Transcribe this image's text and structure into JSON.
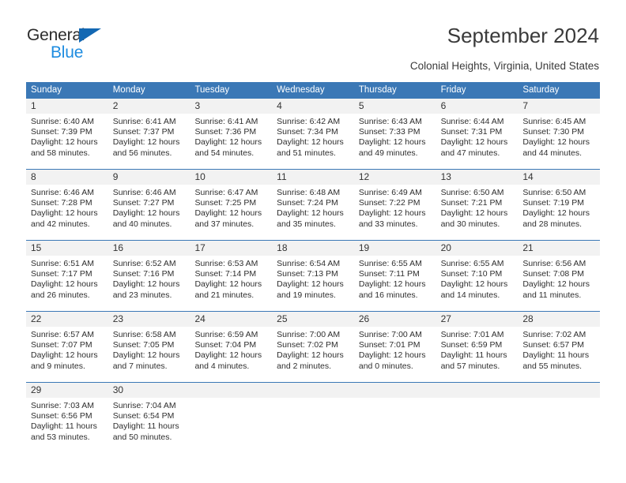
{
  "brand": {
    "name_part1": "General",
    "name_part2": "Blue",
    "accent_color": "#1368b3",
    "blue_text_color": "#1e8ce0"
  },
  "header": {
    "title": "September 2024",
    "subtitle": "Colonial Heights, Virginia, United States"
  },
  "calendar": {
    "header_bg": "#3b78b6",
    "daynum_bg": "#f2f2f2",
    "weekdays": [
      "Sunday",
      "Monday",
      "Tuesday",
      "Wednesday",
      "Thursday",
      "Friday",
      "Saturday"
    ],
    "weeks": [
      {
        "days": [
          {
            "num": "1",
            "sunrise": "Sunrise: 6:40 AM",
            "sunset": "Sunset: 7:39 PM",
            "daylight1": "Daylight: 12 hours",
            "daylight2": "and 58 minutes."
          },
          {
            "num": "2",
            "sunrise": "Sunrise: 6:41 AM",
            "sunset": "Sunset: 7:37 PM",
            "daylight1": "Daylight: 12 hours",
            "daylight2": "and 56 minutes."
          },
          {
            "num": "3",
            "sunrise": "Sunrise: 6:41 AM",
            "sunset": "Sunset: 7:36 PM",
            "daylight1": "Daylight: 12 hours",
            "daylight2": "and 54 minutes."
          },
          {
            "num": "4",
            "sunrise": "Sunrise: 6:42 AM",
            "sunset": "Sunset: 7:34 PM",
            "daylight1": "Daylight: 12 hours",
            "daylight2": "and 51 minutes."
          },
          {
            "num": "5",
            "sunrise": "Sunrise: 6:43 AM",
            "sunset": "Sunset: 7:33 PM",
            "daylight1": "Daylight: 12 hours",
            "daylight2": "and 49 minutes."
          },
          {
            "num": "6",
            "sunrise": "Sunrise: 6:44 AM",
            "sunset": "Sunset: 7:31 PM",
            "daylight1": "Daylight: 12 hours",
            "daylight2": "and 47 minutes."
          },
          {
            "num": "7",
            "sunrise": "Sunrise: 6:45 AM",
            "sunset": "Sunset: 7:30 PM",
            "daylight1": "Daylight: 12 hours",
            "daylight2": "and 44 minutes."
          }
        ]
      },
      {
        "days": [
          {
            "num": "8",
            "sunrise": "Sunrise: 6:46 AM",
            "sunset": "Sunset: 7:28 PM",
            "daylight1": "Daylight: 12 hours",
            "daylight2": "and 42 minutes."
          },
          {
            "num": "9",
            "sunrise": "Sunrise: 6:46 AM",
            "sunset": "Sunset: 7:27 PM",
            "daylight1": "Daylight: 12 hours",
            "daylight2": "and 40 minutes."
          },
          {
            "num": "10",
            "sunrise": "Sunrise: 6:47 AM",
            "sunset": "Sunset: 7:25 PM",
            "daylight1": "Daylight: 12 hours",
            "daylight2": "and 37 minutes."
          },
          {
            "num": "11",
            "sunrise": "Sunrise: 6:48 AM",
            "sunset": "Sunset: 7:24 PM",
            "daylight1": "Daylight: 12 hours",
            "daylight2": "and 35 minutes."
          },
          {
            "num": "12",
            "sunrise": "Sunrise: 6:49 AM",
            "sunset": "Sunset: 7:22 PM",
            "daylight1": "Daylight: 12 hours",
            "daylight2": "and 33 minutes."
          },
          {
            "num": "13",
            "sunrise": "Sunrise: 6:50 AM",
            "sunset": "Sunset: 7:21 PM",
            "daylight1": "Daylight: 12 hours",
            "daylight2": "and 30 minutes."
          },
          {
            "num": "14",
            "sunrise": "Sunrise: 6:50 AM",
            "sunset": "Sunset: 7:19 PM",
            "daylight1": "Daylight: 12 hours",
            "daylight2": "and 28 minutes."
          }
        ]
      },
      {
        "days": [
          {
            "num": "15",
            "sunrise": "Sunrise: 6:51 AM",
            "sunset": "Sunset: 7:17 PM",
            "daylight1": "Daylight: 12 hours",
            "daylight2": "and 26 minutes."
          },
          {
            "num": "16",
            "sunrise": "Sunrise: 6:52 AM",
            "sunset": "Sunset: 7:16 PM",
            "daylight1": "Daylight: 12 hours",
            "daylight2": "and 23 minutes."
          },
          {
            "num": "17",
            "sunrise": "Sunrise: 6:53 AM",
            "sunset": "Sunset: 7:14 PM",
            "daylight1": "Daylight: 12 hours",
            "daylight2": "and 21 minutes."
          },
          {
            "num": "18",
            "sunrise": "Sunrise: 6:54 AM",
            "sunset": "Sunset: 7:13 PM",
            "daylight1": "Daylight: 12 hours",
            "daylight2": "and 19 minutes."
          },
          {
            "num": "19",
            "sunrise": "Sunrise: 6:55 AM",
            "sunset": "Sunset: 7:11 PM",
            "daylight1": "Daylight: 12 hours",
            "daylight2": "and 16 minutes."
          },
          {
            "num": "20",
            "sunrise": "Sunrise: 6:55 AM",
            "sunset": "Sunset: 7:10 PM",
            "daylight1": "Daylight: 12 hours",
            "daylight2": "and 14 minutes."
          },
          {
            "num": "21",
            "sunrise": "Sunrise: 6:56 AM",
            "sunset": "Sunset: 7:08 PM",
            "daylight1": "Daylight: 12 hours",
            "daylight2": "and 11 minutes."
          }
        ]
      },
      {
        "days": [
          {
            "num": "22",
            "sunrise": "Sunrise: 6:57 AM",
            "sunset": "Sunset: 7:07 PM",
            "daylight1": "Daylight: 12 hours",
            "daylight2": "and 9 minutes."
          },
          {
            "num": "23",
            "sunrise": "Sunrise: 6:58 AM",
            "sunset": "Sunset: 7:05 PM",
            "daylight1": "Daylight: 12 hours",
            "daylight2": "and 7 minutes."
          },
          {
            "num": "24",
            "sunrise": "Sunrise: 6:59 AM",
            "sunset": "Sunset: 7:04 PM",
            "daylight1": "Daylight: 12 hours",
            "daylight2": "and 4 minutes."
          },
          {
            "num": "25",
            "sunrise": "Sunrise: 7:00 AM",
            "sunset": "Sunset: 7:02 PM",
            "daylight1": "Daylight: 12 hours",
            "daylight2": "and 2 minutes."
          },
          {
            "num": "26",
            "sunrise": "Sunrise: 7:00 AM",
            "sunset": "Sunset: 7:01 PM",
            "daylight1": "Daylight: 12 hours",
            "daylight2": "and 0 minutes."
          },
          {
            "num": "27",
            "sunrise": "Sunrise: 7:01 AM",
            "sunset": "Sunset: 6:59 PM",
            "daylight1": "Daylight: 11 hours",
            "daylight2": "and 57 minutes."
          },
          {
            "num": "28",
            "sunrise": "Sunrise: 7:02 AM",
            "sunset": "Sunset: 6:57 PM",
            "daylight1": "Daylight: 11 hours",
            "daylight2": "and 55 minutes."
          }
        ]
      },
      {
        "days": [
          {
            "num": "29",
            "sunrise": "Sunrise: 7:03 AM",
            "sunset": "Sunset: 6:56 PM",
            "daylight1": "Daylight: 11 hours",
            "daylight2": "and 53 minutes."
          },
          {
            "num": "30",
            "sunrise": "Sunrise: 7:04 AM",
            "sunset": "Sunset: 6:54 PM",
            "daylight1": "Daylight: 11 hours",
            "daylight2": "and 50 minutes."
          },
          {
            "num": "",
            "sunrise": "",
            "sunset": "",
            "daylight1": "",
            "daylight2": ""
          },
          {
            "num": "",
            "sunrise": "",
            "sunset": "",
            "daylight1": "",
            "daylight2": ""
          },
          {
            "num": "",
            "sunrise": "",
            "sunset": "",
            "daylight1": "",
            "daylight2": ""
          },
          {
            "num": "",
            "sunrise": "",
            "sunset": "",
            "daylight1": "",
            "daylight2": ""
          },
          {
            "num": "",
            "sunrise": "",
            "sunset": "",
            "daylight1": "",
            "daylight2": ""
          }
        ]
      }
    ]
  }
}
